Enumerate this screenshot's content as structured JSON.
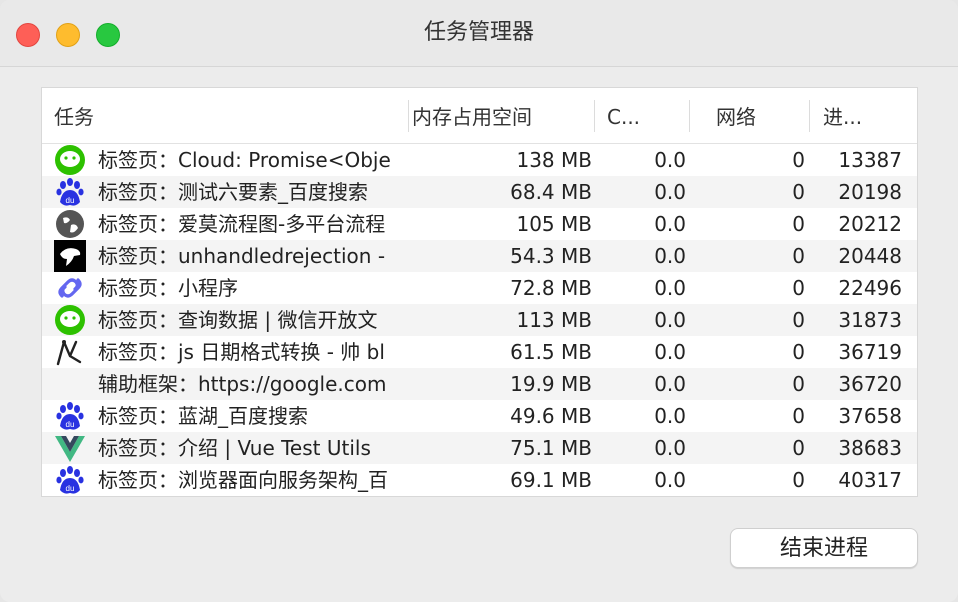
{
  "window": {
    "title": "任务管理器"
  },
  "columns": {
    "task": "任务",
    "memory": "内存占用空间",
    "cpu": "C...",
    "network": "网络",
    "pid": "进..."
  },
  "rows": [
    {
      "icon": "wechat-icon",
      "task": "标签页：Cloud: Promise<Obje",
      "memory": "138 MB",
      "cpu": "0.0",
      "network": "0",
      "pid": "13387"
    },
    {
      "icon": "baidu-icon",
      "task": "标签页：测试六要素_百度搜索",
      "memory": "68.4 MB",
      "cpu": "0.0",
      "network": "0",
      "pid": "20198"
    },
    {
      "icon": "globe-icon",
      "task": "标签页：爱莫流程图-多平台流程",
      "memory": "105 MB",
      "cpu": "0.0",
      "network": "0",
      "pid": "20212"
    },
    {
      "icon": "bird-icon",
      "task": "标签页：unhandledrejection -",
      "memory": "54.3 MB",
      "cpu": "0.0",
      "network": "0",
      "pid": "20448"
    },
    {
      "icon": "mini-program-icon",
      "task": "标签页：小程序",
      "memory": "72.8 MB",
      "cpu": "0.0",
      "network": "0",
      "pid": "22496"
    },
    {
      "icon": "wechat-icon",
      "task": "标签页：查询数据 | 微信开放文",
      "memory": "113 MB",
      "cpu": "0.0",
      "network": "0",
      "pid": "31873"
    },
    {
      "icon": "pen-icon",
      "task": "标签页：js 日期格式转换 - 帅 bl",
      "memory": "61.5 MB",
      "cpu": "0.0",
      "network": "0",
      "pid": "36719"
    },
    {
      "icon": "",
      "task": "辅助框架：https://google.com",
      "memory": "19.9 MB",
      "cpu": "0.0",
      "network": "0",
      "pid": "36720"
    },
    {
      "icon": "baidu-icon",
      "task": "标签页：蓝湖_百度搜索",
      "memory": "49.6 MB",
      "cpu": "0.0",
      "network": "0",
      "pid": "37658"
    },
    {
      "icon": "vue-icon",
      "task": "标签页：介绍 | Vue Test Utils",
      "memory": "75.1 MB",
      "cpu": "0.0",
      "network": "0",
      "pid": "38683"
    },
    {
      "icon": "baidu-icon",
      "task": "标签页：浏览器面向服务架构_百",
      "memory": "69.1 MB",
      "cpu": "0.0",
      "network": "0",
      "pid": "40317"
    }
  ],
  "actions": {
    "end_process": "结束进程"
  },
  "colors": {
    "wechat": "#2dc100",
    "baidu": "#2932e1",
    "vue_green": "#41b883",
    "vue_dark": "#35495e",
    "mini_program": "#6467f0"
  }
}
